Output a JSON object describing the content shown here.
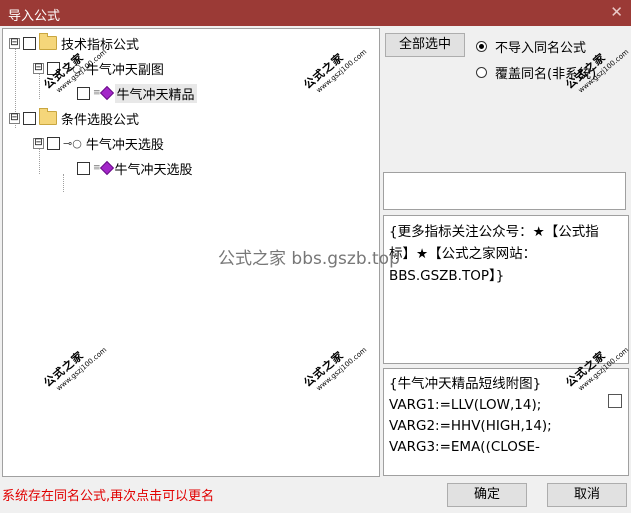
{
  "window": {
    "title": "导入公式",
    "close_glyph": "✕"
  },
  "tree": {
    "items": [
      {
        "label": "技术指标公式",
        "expander": "⊟",
        "icon": "folder-icon"
      },
      {
        "label": "牛气冲天副图",
        "expander": "⊟",
        "icon": "key-icon"
      },
      {
        "label": "牛气冲天精品",
        "expander": "",
        "icon": "formula-icon"
      },
      {
        "label": "条件选股公式",
        "expander": "⊟",
        "icon": "folder-icon"
      },
      {
        "label": "牛气冲天选股",
        "expander": "⊟",
        "icon": "key-icon"
      },
      {
        "label": "牛气冲天选股",
        "expander": "",
        "icon": "formula-icon"
      }
    ]
  },
  "buttons": {
    "select_all": "全部选中",
    "confirm": "确定",
    "cancel": "取消"
  },
  "options": {
    "no_import": "不导入同名公式",
    "overwrite": "覆盖同名(非系统)",
    "selected": "no_import"
  },
  "notes": "{更多指标关注公众号：★【公式指标】★【公式之家网站：BBS.GSZB.TOP】}",
  "code": "{牛气冲天精品短线附图}\nVARG1:=LLV(LOW,14);\nVARG2:=HHV(HIGH,14);\nVARG3:=EMA((CLOSE-",
  "status": "系统存在同名公式,再次点击可以更名",
  "watermark": {
    "main": "公式之家",
    "url": "www.gszj100.com",
    "center": "公式之家 bbs.gszb.top"
  }
}
